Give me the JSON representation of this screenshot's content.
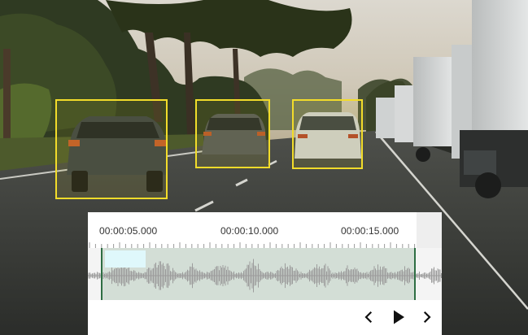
{
  "timeline": {
    "timestamps": [
      "00:00:05.000",
      "00:00:10.000",
      "00:00:15.000"
    ]
  },
  "detections": {
    "count": 3,
    "color": "#f2dc2a"
  },
  "colors": {
    "selection_fill": "#d3ded6",
    "handle": "#2e6e43",
    "subtitle_block": "#dff8fb",
    "waveform": "#9c9c9c"
  },
  "icons": {
    "prev": "chevron-left-icon",
    "play": "play-icon",
    "next": "chevron-right-icon"
  }
}
